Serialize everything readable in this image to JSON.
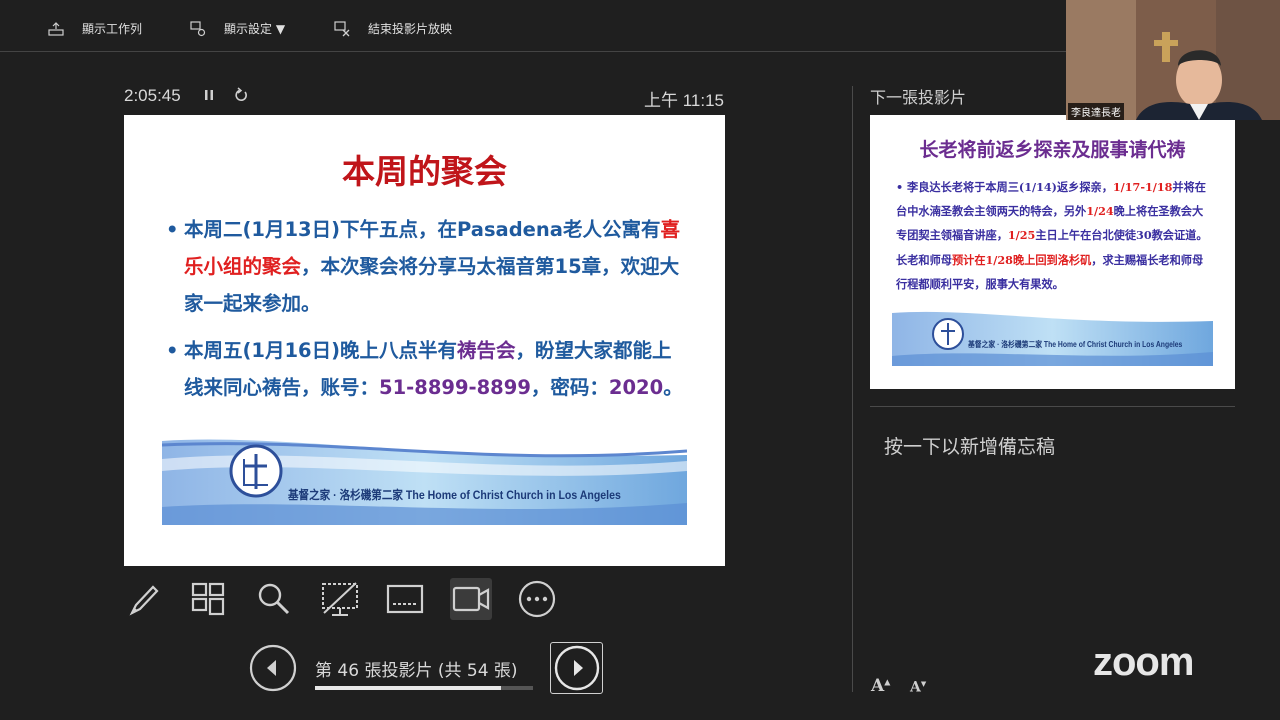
{
  "topbar": {
    "show_taskbar": "顯示工作列",
    "display_settings": "顯示設定 ▼",
    "end_slideshow": "結束投影片放映"
  },
  "presenter": {
    "timer": "2:05:45",
    "clock": "上午 11:15",
    "slide_counter": "第 46 張投影片 (共 54 張)",
    "progress": 0.852
  },
  "current_slide": {
    "title": "本周的聚会",
    "bullet1_a": "本周二(1月13日)下午五点，在Pasadena老人公寓有",
    "bullet1_red": "喜乐小组的聚会",
    "bullet1_b": "，本次聚会将分享马太福音第15章，欢迎大家一起来参加。",
    "bullet2_a": "本周五(1月16日)晚上八点半有",
    "bullet2_purple": "祷告会",
    "bullet2_b": "，盼望大家都能上线来同心祷告，账号：",
    "bullet2_account": "51-8899-8899",
    "bullet2_c": "，密码：",
    "bullet2_password": "2020",
    "bullet2_end": "。",
    "banner": "基督之家 · 洛杉磯第二家  The Home of Christ Church in Los Angeles"
  },
  "next_slide": {
    "label": "下一張投影片",
    "title": "长老将前返乡探亲及服事请代祷",
    "p1": "李良达长老将于本周三(1/14)返乡探亲，",
    "p1_red": "1/17-1/18",
    "p2": "并将在台中水湳圣教会主领两天的特会，另外",
    "p2_red": "1/24",
    "p3": "晚上将在圣教会大专团契主领福音讲座，",
    "p3_red": "1/25",
    "p4": "主日上午在台北使徒30教会证道。长老和师母",
    "p4_red": "预计在1/28晚上回到洛杉矶",
    "p5": "，求主赐福长老和师母行程都顺利平安，服事大有果效。",
    "banner": "基督之家 · 洛杉磯第二家  The Home of Christ Church in Los Angeles"
  },
  "notes_placeholder": "按一下以新增備忘稿",
  "font_buttons": {
    "increase": "A",
    "decrease": "A"
  },
  "zoom_logo": "zoom",
  "video": {
    "participant_name": "李良達長老"
  },
  "icons": [
    "taskbar-icon",
    "display-settings-icon",
    "end-slideshow-icon",
    "pause-icon",
    "reset-icon",
    "pen-icon",
    "see-all-slides-icon",
    "zoom-in-icon",
    "black-screen-icon",
    "subtitles-icon",
    "camera-icon",
    "more-options-icon",
    "previous-icon",
    "next-icon"
  ]
}
